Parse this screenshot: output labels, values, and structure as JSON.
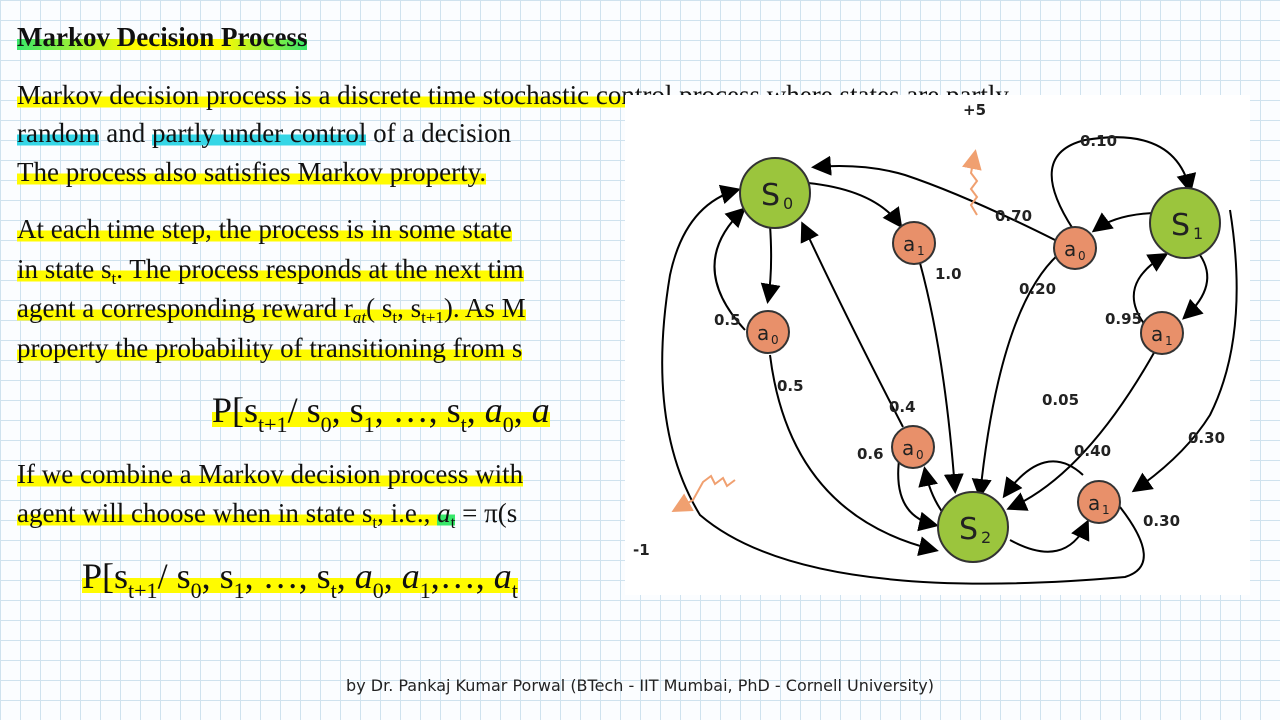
{
  "title": "Markov Decision Process",
  "para1": {
    "l1": "Markov decision process is a discrete time stochastic control process where states are partly",
    "l2a": "random",
    "l2b": " and ",
    "l2c": "partly under control",
    "l2d": " of a decision",
    "l3": "The process also satisfies Markov property."
  },
  "para2": {
    "l1": "At each time step, the process is in some state",
    "l2a": "in state s",
    "l2b": "t",
    "l2c": ". The process responds at the next tim",
    "l3a": "agent a corresponding reward r",
    "l3b": "at",
    "l3c": "( s",
    "l3d": "t",
    "l3e": ", s",
    "l3f": "t+1",
    "l3g": "). As M",
    "l4": "property the probability of transitioning from s"
  },
  "eq1": {
    "a": "P[s",
    "b": "t+1",
    "c": "/ s",
    "d": "0",
    "e": ", s",
    "f": "1",
    "g": ", …, s",
    "h": "t",
    "i": ", ",
    "j": "a",
    "k": "0",
    "l": ", ",
    "m": "a"
  },
  "para3": {
    "l1": "If we combine a Markov decision process with",
    "l2a": "agent will choose when in state s",
    "l2b": "t",
    "l2c": ", i.e., ",
    "l2d": "a",
    "l2e": "t",
    "l2f": " = π(s"
  },
  "eq2": {
    "a": "P[s",
    "b": "t+1",
    "c": "/ s",
    "d": "0",
    "e": ", s",
    "f": "1",
    "g": ", …, s",
    "h": "t",
    "i": ", ",
    "j": "a",
    "k": "0",
    "l": ", ",
    "m": "a",
    "n": "1",
    "o": ",…, ",
    "p": "a",
    "q": "t"
  },
  "diagram": {
    "states": [
      {
        "label": "S",
        "sub": "0"
      },
      {
        "label": "S",
        "sub": "1"
      },
      {
        "label": "S",
        "sub": "2"
      }
    ],
    "actions": [
      {
        "label": "a",
        "sub": "1"
      },
      {
        "label": "a",
        "sub": "0"
      },
      {
        "label": "a",
        "sub": "0"
      },
      {
        "label": "a",
        "sub": "1"
      },
      {
        "label": "a",
        "sub": "0"
      },
      {
        "label": "a",
        "sub": "1"
      }
    ],
    "edge_labels": [
      "0.10",
      "0.70",
      "1.0",
      "0.20",
      "0.5",
      "0.95",
      "0.5",
      "0.05",
      "0.4",
      "0.6",
      "0.40",
      "0.30",
      "0.30"
    ],
    "rewards": [
      "+5",
      "-1"
    ],
    "colors": {
      "state": "#9bc53d",
      "action": "#e8906a",
      "reward_arrow": "#f0a070"
    }
  },
  "footer": "by Dr. Pankaj Kumar Porwal (BTech - IIT Mumbai, PhD - Cornell University)"
}
